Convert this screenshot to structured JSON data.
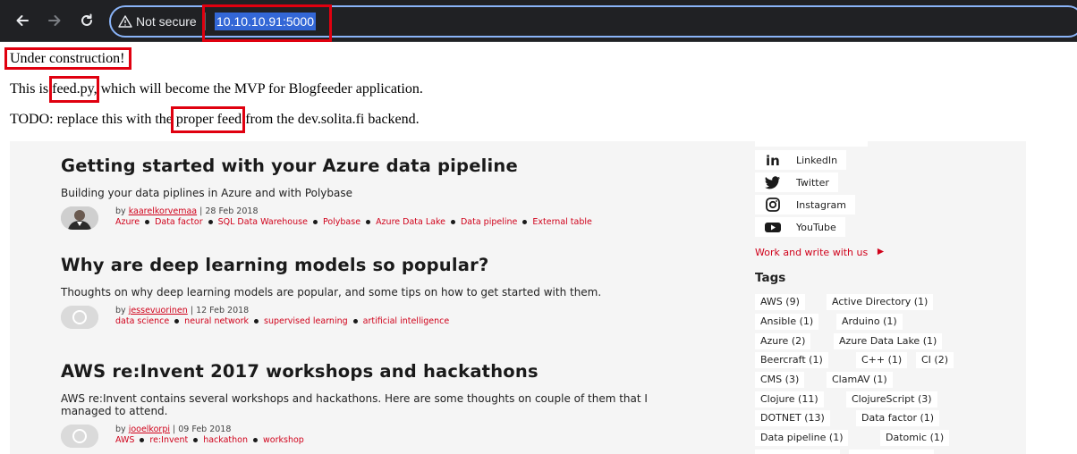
{
  "browser": {
    "security_label": "Not secure",
    "url": "10.10.10.91:5000"
  },
  "page": {
    "line1": "Under construction!",
    "line2_prefix": "This is ",
    "line2_highlight": "feed.py,",
    "line2_suffix": " which will become the MVP for Blogfeeder application.",
    "line3_prefix": "TODO: replace this with the ",
    "line3_highlight": "proper feed",
    "line3_suffix": " from the dev.solita.fi backend."
  },
  "posts": [
    {
      "title": "Getting started with your Azure data pipeline",
      "subtitle": "Building your data piplines in Azure and with Polybase",
      "by": "by",
      "author": "kaarelkorvemaa",
      "sep": "|",
      "date": "28 Feb 2018",
      "tags": [
        "Azure",
        "Data factor",
        "SQL Data Warehouse",
        "Polybase",
        "Azure Data Lake",
        "Data pipeline",
        "External table"
      ]
    },
    {
      "title": "Why are deep learning models so popular?",
      "subtitle": "Thoughts on why deep learning models are popular, and some tips on how to get started with them.",
      "by": "by",
      "author": "jessevuorinen",
      "sep": "|",
      "date": "12 Feb 2018",
      "tags": [
        "data science",
        "neural network",
        "supervised learning",
        "artificial intelligence"
      ]
    },
    {
      "title": "AWS re:Invent 2017 workshops and hackathons",
      "subtitle": "AWS re:Invent contains several workshops and hackathons. Here are some thoughts on couple of them that I managed to attend.",
      "by": "by",
      "author": "jooelkorpi",
      "sep": "|",
      "date": "09 Feb 2018",
      "tags": [
        "AWS",
        "re:Invent",
        "hackathon",
        "workshop"
      ]
    }
  ],
  "sidebar": {
    "social": [
      {
        "label": "LinkedIn",
        "icon": "linkedin-icon"
      },
      {
        "label": "Twitter",
        "icon": "twitter-icon"
      },
      {
        "label": "Instagram",
        "icon": "instagram-icon"
      },
      {
        "label": "YouTube",
        "icon": "youtube-icon"
      }
    ],
    "work_link": "Work and write with us",
    "tags_title": "Tags",
    "tags": [
      "AWS (9)",
      "Active Directory (1)",
      "Ansible (1)",
      "Arduino (1)",
      "Azure (2)",
      "Azure Data Lake (1)",
      "Beercraft (1)",
      "C++ (1)",
      "CI (2)",
      "CMS (3)",
      "ClamAV (1)",
      "Clojure (11)",
      "ClojureScript (3)",
      "DOTNET (13)",
      "Data factor (1)",
      "Data pipeline (1)",
      "Datomic (1)"
    ]
  },
  "colors": {
    "highlight_box": "#e0000f",
    "accent_red": "#d0021b",
    "chrome_bg": "#202124",
    "omnibox_border": "#8ab4f8",
    "url_selection": "#3367d6"
  }
}
